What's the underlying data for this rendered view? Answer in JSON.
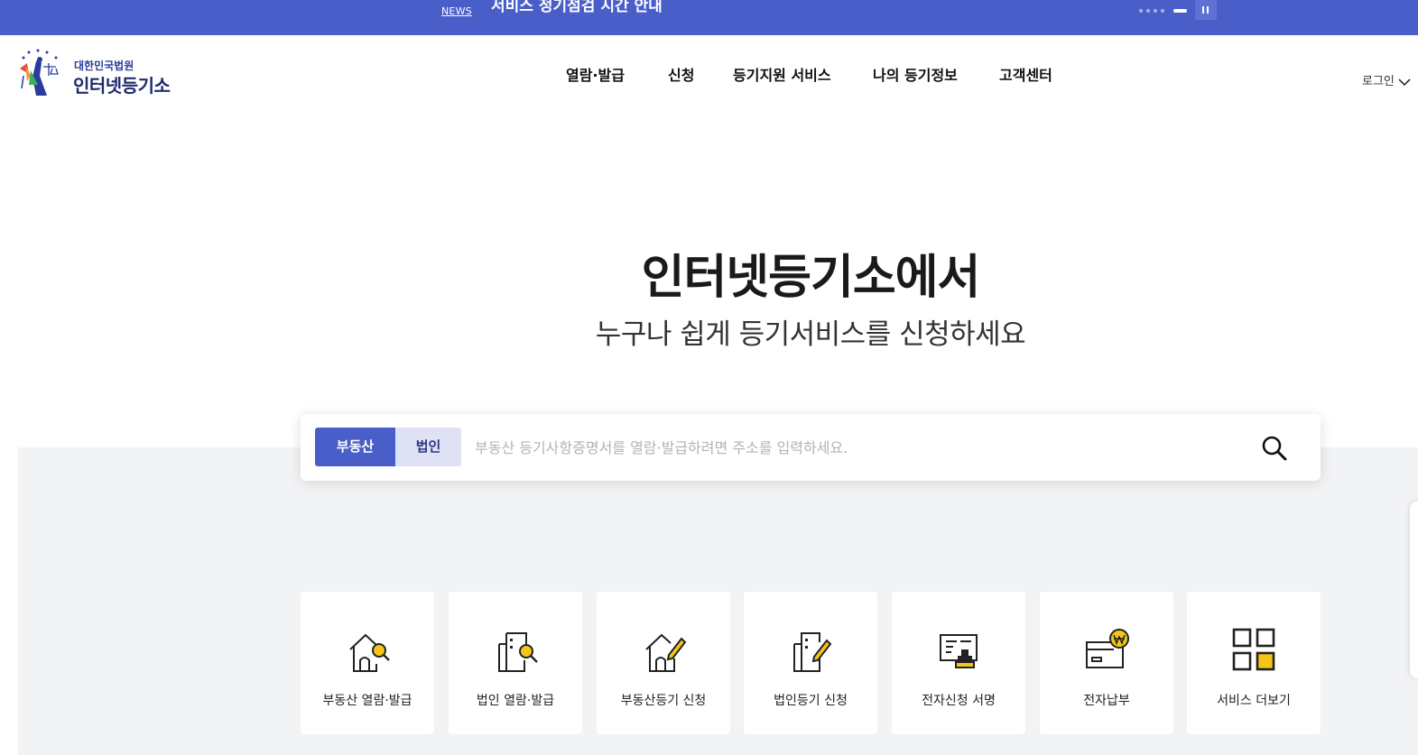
{
  "news": {
    "tag": "NEWS",
    "text": "서비스 정기점검 시간 안내",
    "pause_icon": "pause-icon"
  },
  "logo": {
    "sub": "대한민국법원",
    "main": "인터넷등기소"
  },
  "gnb": {
    "items": [
      "열람·발급",
      "신청",
      "등기지원 서비스",
      "나의 등기정보",
      "고객센터"
    ]
  },
  "login": {
    "label": "로그인",
    "icon": "chevron-down-icon"
  },
  "hero": {
    "title": "인터넷등기소에서",
    "subtitle": "누구나 쉽게 등기서비스를 신청하세요"
  },
  "search": {
    "tabs": [
      "부동산",
      "법인"
    ],
    "selected_tab": "부동산",
    "placeholder": "부동산 등기사항증명서를 열람·발급하려면 주소를 입력하세요.",
    "value": "",
    "icon": "search-icon"
  },
  "quick_menu": [
    {
      "label": "부동산 열람·발급",
      "icon": "house-search-icon"
    },
    {
      "label": "법인 열람·발급",
      "icon": "building-search-icon"
    },
    {
      "label": "부동산등기 신청",
      "icon": "house-pencil-icon"
    },
    {
      "label": "법인등기 신청",
      "icon": "building-pencil-icon"
    },
    {
      "label": "전자신청 서명",
      "icon": "document-stamp-icon"
    },
    {
      "label": "전자납부",
      "icon": "card-won-icon"
    },
    {
      "label": "서비스 더보기",
      "icon": "grid-icon"
    }
  ],
  "colors": {
    "brand": "#4a5ec9",
    "accent_yellow": "#f5c518",
    "background_gray": "#f2f3f5"
  }
}
